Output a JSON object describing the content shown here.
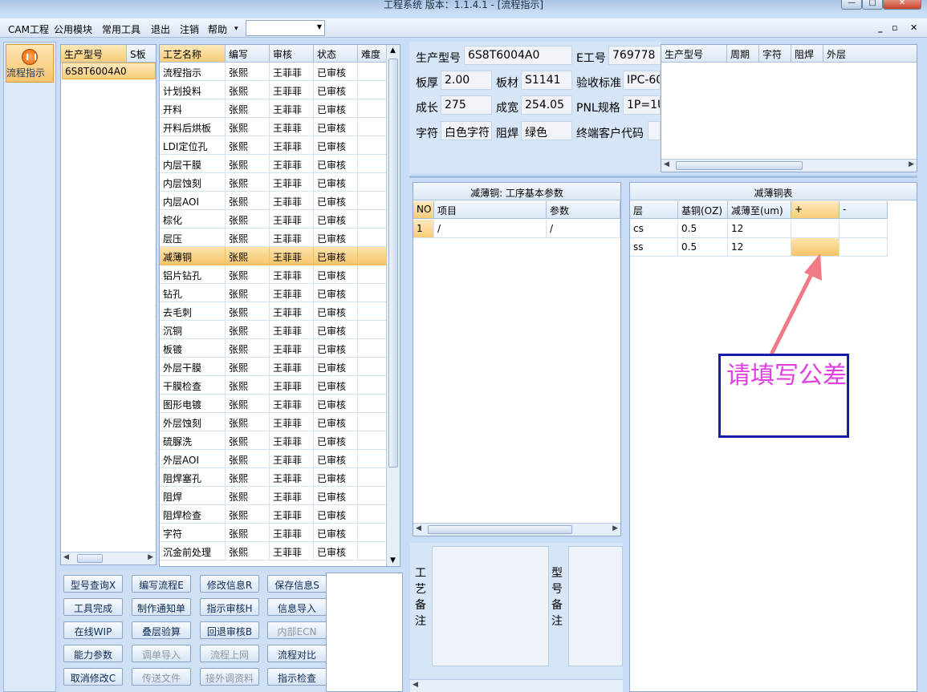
{
  "window": {
    "title": "工程系统    版本：1.1.4.1 - [流程指示]",
    "minimize": "—",
    "maximize": "□",
    "close": "✕"
  },
  "menu": {
    "items": [
      "CAM工程",
      "公用模块",
      "常用工具",
      "退出",
      "注销",
      "帮助"
    ],
    "help_arrow": "▾",
    "combo_value": ""
  },
  "nav": {
    "flow_label": "流程指示"
  },
  "product_list": {
    "headers": [
      "生产型号",
      "S板"
    ],
    "rows": [
      "6S8T6004A0"
    ]
  },
  "process_list": {
    "headers": [
      "工艺名称",
      "编写",
      "审核",
      "状态",
      "难度"
    ],
    "selected_index": 10,
    "rows": [
      {
        "name": "流程指示",
        "writer": "张熙",
        "reviewer": "王菲菲",
        "status": "已审核"
      },
      {
        "name": "计划投料",
        "writer": "张熙",
        "reviewer": "王菲菲",
        "status": "已审核"
      },
      {
        "name": "开料",
        "writer": "张熙",
        "reviewer": "王菲菲",
        "status": "已审核"
      },
      {
        "name": "开料后烘板",
        "writer": "张熙",
        "reviewer": "王菲菲",
        "status": "已审核"
      },
      {
        "name": "LDI定位孔",
        "writer": "张熙",
        "reviewer": "王菲菲",
        "status": "已审核"
      },
      {
        "name": "内层干膜",
        "writer": "张熙",
        "reviewer": "王菲菲",
        "status": "已审核"
      },
      {
        "name": "内层蚀刻",
        "writer": "张熙",
        "reviewer": "王菲菲",
        "status": "已审核"
      },
      {
        "name": "内层AOI",
        "writer": "张熙",
        "reviewer": "王菲菲",
        "status": "已审核"
      },
      {
        "name": "棕化",
        "writer": "张熙",
        "reviewer": "王菲菲",
        "status": "已审核"
      },
      {
        "name": "层压",
        "writer": "张熙",
        "reviewer": "王菲菲",
        "status": "已审核"
      },
      {
        "name": "减薄铜",
        "writer": "张熙",
        "reviewer": "王菲菲",
        "status": "已审核"
      },
      {
        "name": "铝片钻孔",
        "writer": "张熙",
        "reviewer": "王菲菲",
        "status": "已审核"
      },
      {
        "name": "钻孔",
        "writer": "张熙",
        "reviewer": "王菲菲",
        "status": "已审核"
      },
      {
        "name": "去毛刺",
        "writer": "张熙",
        "reviewer": "王菲菲",
        "status": "已审核"
      },
      {
        "name": "沉铜",
        "writer": "张熙",
        "reviewer": "王菲菲",
        "status": "已审核"
      },
      {
        "name": "板镀",
        "writer": "张熙",
        "reviewer": "王菲菲",
        "status": "已审核"
      },
      {
        "name": "外层干膜",
        "writer": "张熙",
        "reviewer": "王菲菲",
        "status": "已审核"
      },
      {
        "name": "干膜检查",
        "writer": "张熙",
        "reviewer": "王菲菲",
        "status": "已审核"
      },
      {
        "name": "图形电镀",
        "writer": "张熙",
        "reviewer": "王菲菲",
        "status": "已审核"
      },
      {
        "name": "外层蚀刻",
        "writer": "张熙",
        "reviewer": "王菲菲",
        "status": "已审核"
      },
      {
        "name": "硫脲洗",
        "writer": "张熙",
        "reviewer": "王菲菲",
        "status": "已审核"
      },
      {
        "name": "外层AOI",
        "writer": "张熙",
        "reviewer": "王菲菲",
        "status": "已审核"
      },
      {
        "name": "阻焊塞孔",
        "writer": "张熙",
        "reviewer": "王菲菲",
        "status": "已审核"
      },
      {
        "name": "阻焊",
        "writer": "张熙",
        "reviewer": "王菲菲",
        "status": "已审核"
      },
      {
        "name": "阻焊检查",
        "writer": "张熙",
        "reviewer": "王菲菲",
        "status": "已审核"
      },
      {
        "name": "字符",
        "writer": "张熙",
        "reviewer": "王菲菲",
        "status": "已审核"
      },
      {
        "name": "沉金前处理",
        "writer": "张熙",
        "reviewer": "王菲菲",
        "status": "已审核"
      }
    ]
  },
  "buttons": [
    {
      "label": "型号查询X",
      "enabled": true
    },
    {
      "label": "编写流程E",
      "enabled": true
    },
    {
      "label": "修改信息R",
      "enabled": true
    },
    {
      "label": "保存信息S",
      "enabled": true
    },
    {
      "label": "工具完成",
      "enabled": true
    },
    {
      "label": "制作通知单",
      "enabled": true
    },
    {
      "label": "指示审核H",
      "enabled": true
    },
    {
      "label": "信息导入",
      "enabled": true
    },
    {
      "label": "在线WIP",
      "enabled": true
    },
    {
      "label": "叠层验算",
      "enabled": true
    },
    {
      "label": "回退审核B",
      "enabled": true
    },
    {
      "label": "内部ECN",
      "enabled": false
    },
    {
      "label": "能力参数",
      "enabled": true
    },
    {
      "label": "调单导入",
      "enabled": false
    },
    {
      "label": "流程上网",
      "enabled": false
    },
    {
      "label": "流程对比",
      "enabled": true
    },
    {
      "label": "取消修改C",
      "enabled": true
    },
    {
      "label": "传送文件",
      "enabled": false
    },
    {
      "label": "接外调资料",
      "enabled": false
    },
    {
      "label": "指示检查",
      "enabled": true
    }
  ],
  "info": {
    "model_label": "生产型号",
    "model_value": "6S8T6004A0",
    "eno_label": "E工号",
    "eno_value": "769778",
    "thickness_label": "板厚",
    "thickness_value": "2.00",
    "material_label": "板材",
    "material_value": "S1141",
    "standard_label": "验收标准",
    "standard_value": "IPC-60",
    "length_label": "成长",
    "length_value": "275",
    "width_label": "成宽",
    "width_value": "254.05",
    "pnl_label": "PNL规格",
    "pnl_value": "1P=1U",
    "char_label": "字符",
    "char_value": "白色字符",
    "mask_label": "阻焊",
    "mask_value": "绿色",
    "customer_label": "终端客户代码",
    "customer_value": ""
  },
  "prod_grid2": {
    "headers": [
      "生产型号",
      "周期",
      "字符",
      "阻焊",
      "外层"
    ]
  },
  "params": {
    "title": "减薄铜: 工序基本参数",
    "headers": [
      "NO",
      "项目",
      "参数"
    ],
    "rows": [
      {
        "no": "1",
        "item": "/",
        "param": "/"
      }
    ]
  },
  "copper": {
    "title": "减薄铜表",
    "headers": [
      "层",
      "基铜(OZ)",
      "减薄至(um)",
      "+",
      "-"
    ],
    "rows": [
      {
        "layer": "cs",
        "base": "0.5",
        "target": "12",
        "plus": "",
        "minus": ""
      },
      {
        "layer": "ss",
        "base": "0.5",
        "target": "12",
        "plus": "",
        "minus": ""
      }
    ]
  },
  "remarks": {
    "process_label": "工艺备注",
    "model_label": "型号备注"
  },
  "annotation": {
    "text": "请填写公差",
    "arrow_color": "#f07a86",
    "text_color": "#e040e0",
    "box_color": "#1a1aa8"
  }
}
